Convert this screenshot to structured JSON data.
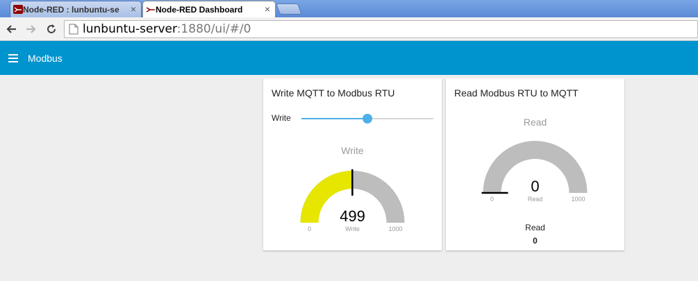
{
  "browser": {
    "tabs": [
      {
        "title": "Node-RED : lunbuntu-se",
        "active": false
      },
      {
        "title": "Node-RED Dashboard",
        "active": true
      }
    ],
    "url_host": "lunbuntu-server",
    "url_rest": ":1880/ui/#/0",
    "close_glyph": "×"
  },
  "dashboard": {
    "title": "Modbus",
    "accent_color": "#0094ce"
  },
  "cards": [
    {
      "title": "Write MQTT to Modbus RTU",
      "slider": {
        "label": "Write",
        "value": 499,
        "min": 0,
        "max": 1000
      },
      "gauge": {
        "title": "Write",
        "value": 499,
        "value_text": "499",
        "min": 0,
        "max": 1000,
        "min_text": "0",
        "max_text": "1000",
        "units": "Write",
        "fill_color": "#e6e600"
      }
    },
    {
      "title": "Read Modbus RTU to MQTT",
      "gauge": {
        "title": "Read",
        "value": 0,
        "value_text": "0",
        "min": 0,
        "max": 1000,
        "min_text": "0",
        "max_text": "1000",
        "units": "Read",
        "fill_color": "#e6e600"
      },
      "text": {
        "label": "Read",
        "value": "0"
      }
    }
  ]
}
